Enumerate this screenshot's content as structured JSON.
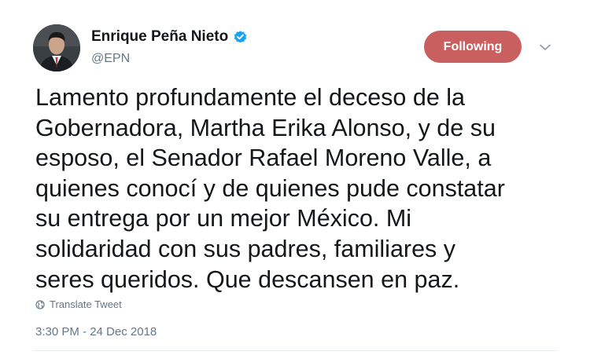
{
  "author": {
    "display_name": "Enrique Peña Nieto",
    "handle": "@EPN",
    "verified": true
  },
  "follow_button": {
    "label": "Following",
    "color": "#c9605f"
  },
  "menu": {
    "icon": "chevron-down-icon"
  },
  "tweet": {
    "lines": [
      "Lamento profundamente el deceso de la",
      "Gobernadora, Martha Erika Alonso, y de su",
      "esposo, el Senador Rafael Moreno Valle, a",
      "quienes conocí y de quienes pude constatar",
      "su entrega por un mejor México. Mi",
      "solidaridad con sus padres, familiares y",
      "seres queridos. Que descansen en paz."
    ]
  },
  "translate": {
    "label": "Translate Tweet",
    "icon": "globe-icon"
  },
  "timestamp": "3:30 PM - 24 Dec 2018",
  "colors": {
    "text": "#14171a",
    "secondary": "#657786",
    "verified_badge": "#1da1f2"
  }
}
